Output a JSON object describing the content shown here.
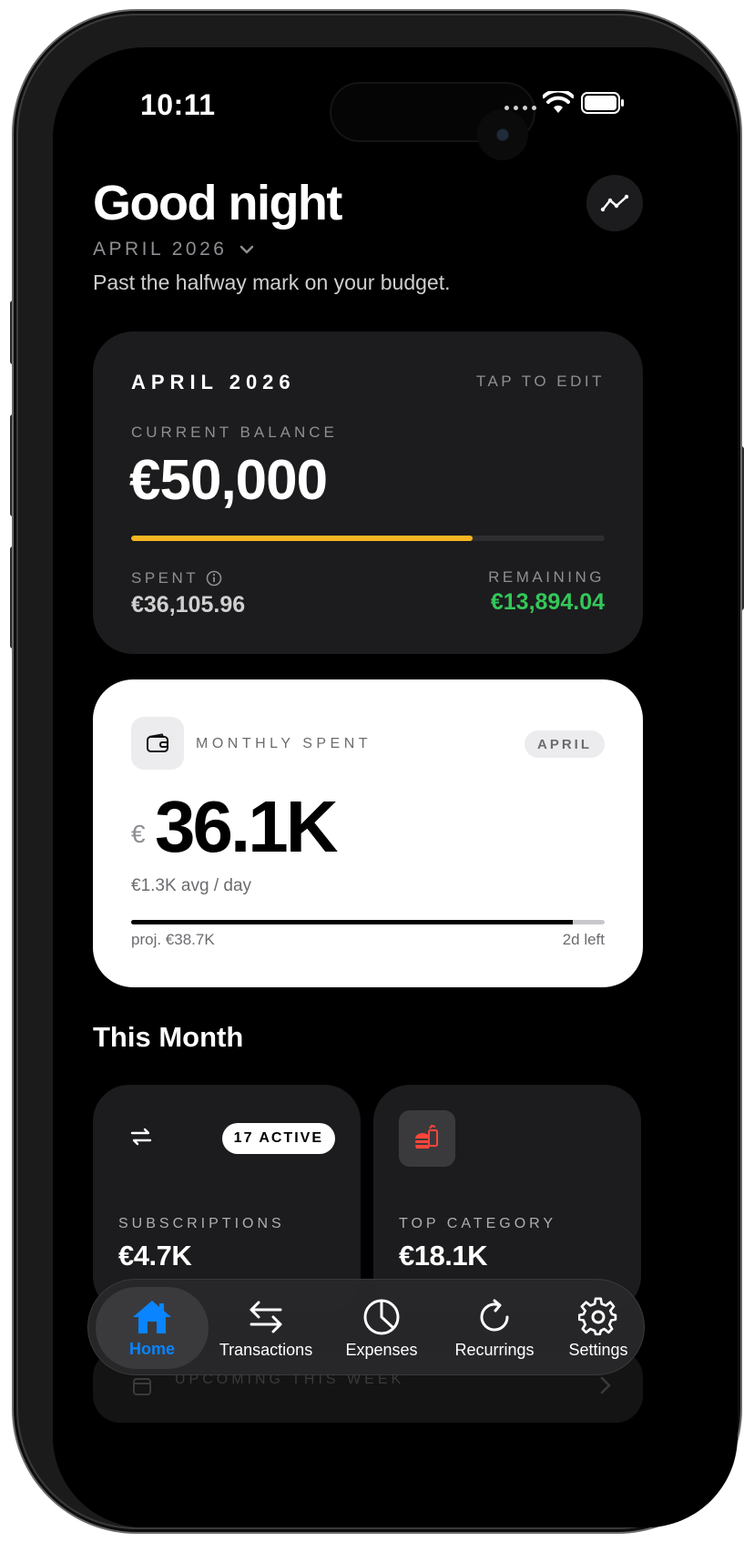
{
  "status": {
    "time": "10:11"
  },
  "header": {
    "greeting": "Good night",
    "month_selector": "APRIL 2026",
    "subtitle": "Past the halfway mark on your budget."
  },
  "balance_card": {
    "month": "APRIL 2026",
    "edit_hint": "TAP TO EDIT",
    "balance_label": "CURRENT BALANCE",
    "balance": "€50,000",
    "spent_label": "SPENT",
    "spent": "€36,105.96",
    "remaining_label": "REMAINING",
    "remaining": "€13,894.04",
    "progress_fraction": 0.722,
    "progress_color": "#f5b622",
    "remaining_color": "#34c759"
  },
  "monthly_card": {
    "label": "MONTHLY SPENT",
    "badge": "APRIL",
    "currency": "€",
    "value": "36.1K",
    "avg": "€1.3K avg / day",
    "projection": "proj. €38.7K",
    "days_left": "2d left",
    "progress_fraction": 0.933
  },
  "this_month": {
    "title": "This Month",
    "subscriptions": {
      "badge": "17 ACTIVE",
      "label": "SUBSCRIPTIONS",
      "value": "€4.7K",
      "icon": "repeat-icon"
    },
    "top_category": {
      "label": "TOP CATEGORY",
      "value": "€18.1K",
      "icon": "food-icon"
    }
  },
  "upcoming": {
    "label": "UPCOMING THIS WEEK"
  },
  "tabbar": {
    "accent": "#0a84ff",
    "items": [
      {
        "label": "Home",
        "icon": "home-icon"
      },
      {
        "label": "Transactions",
        "icon": "arrows-icon"
      },
      {
        "label": "Expenses",
        "icon": "pie-chart-icon"
      },
      {
        "label": "Recurrings",
        "icon": "refresh-icon"
      },
      {
        "label": "Settings",
        "icon": "gear-icon"
      }
    ]
  }
}
